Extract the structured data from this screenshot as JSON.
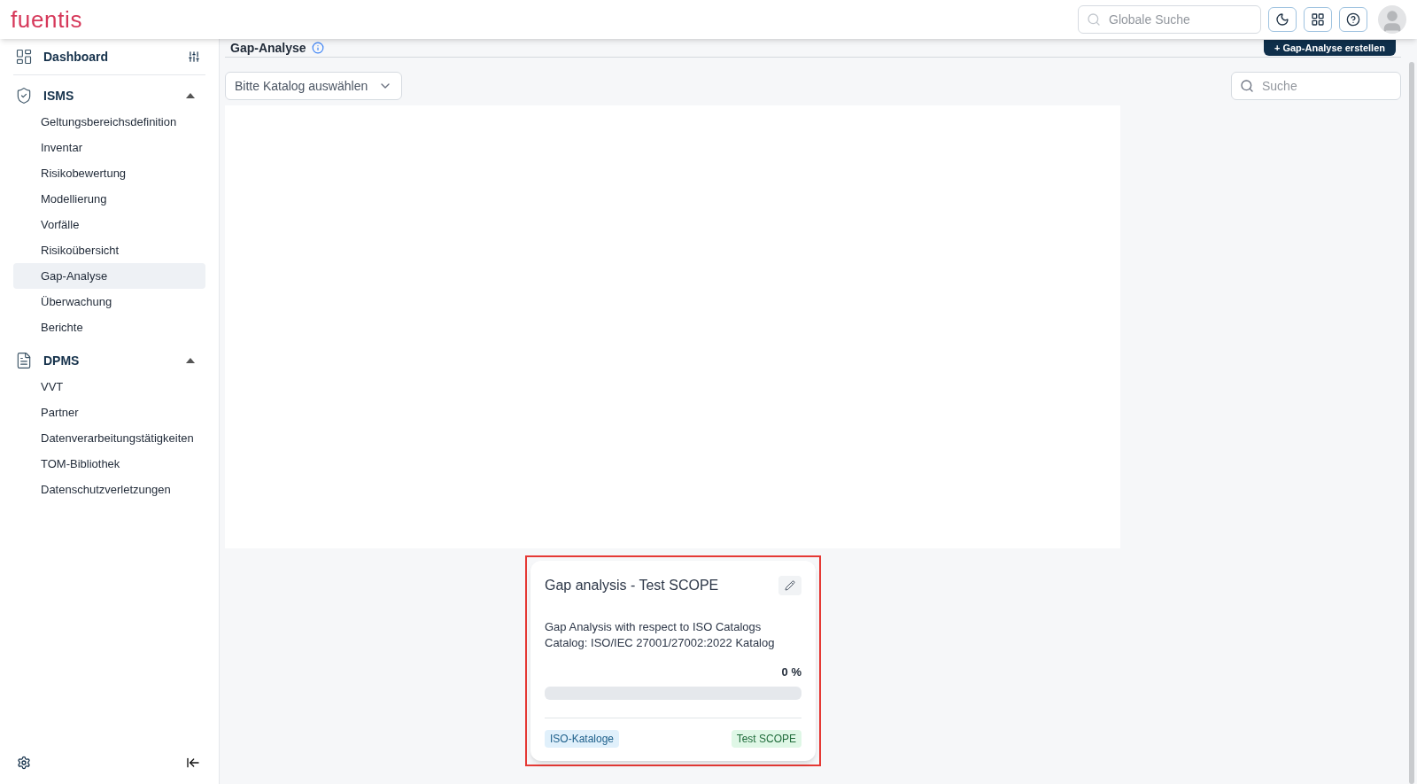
{
  "header": {
    "logo": "fuentis",
    "search": {
      "placeholder": "Globale Suche"
    }
  },
  "sidebar": {
    "items": [
      {
        "kind": "top",
        "label": "Dashboard"
      },
      {
        "kind": "group",
        "label": "ISMS",
        "expanded": true,
        "children": [
          {
            "label": "Geltungsbereichsdefinition",
            "selected": false
          },
          {
            "label": "Inventar",
            "selected": false
          },
          {
            "label": "Risikobewertung",
            "selected": false
          },
          {
            "label": "Modellierung",
            "selected": false
          },
          {
            "label": "Vorfälle",
            "selected": false
          },
          {
            "label": "Risikoübersicht",
            "selected": false
          },
          {
            "label": "Gap-Analyse",
            "selected": true
          },
          {
            "label": "Überwachung",
            "selected": false
          },
          {
            "label": "Berichte",
            "selected": false
          }
        ]
      },
      {
        "kind": "group",
        "label": "DPMS",
        "expanded": true,
        "children": [
          {
            "label": "VVT",
            "selected": false
          },
          {
            "label": "Partner",
            "selected": false
          },
          {
            "label": "Datenverarbeitungstätigkeiten",
            "selected": false
          },
          {
            "label": "TOM-Bibliothek",
            "selected": false
          },
          {
            "label": "Datenschutzverletzungen",
            "selected": false
          }
        ]
      }
    ]
  },
  "page": {
    "title": "Gap-Analyse",
    "create_button": "+ Gap-Analyse erstellen",
    "catalog_select": {
      "placeholder": "Bitte Katalog auswählen"
    },
    "search": {
      "placeholder": "Suche"
    }
  },
  "cards": [
    {
      "title": "Gap analysis - Test SCOPE",
      "description": "Gap Analysis with respect to ISO Catalogs",
      "catalog": "Catalog: ISO/IEC 27001/27002:2022 Katalog",
      "percent": "0 %",
      "level": 0,
      "highlighted": true,
      "tags": [
        {
          "label": "ISO-Kataloge",
          "color": "#e0f0fb"
        },
        {
          "label": "Test SCOPE",
          "color": "#dff7e6"
        }
      ]
    }
  ]
}
